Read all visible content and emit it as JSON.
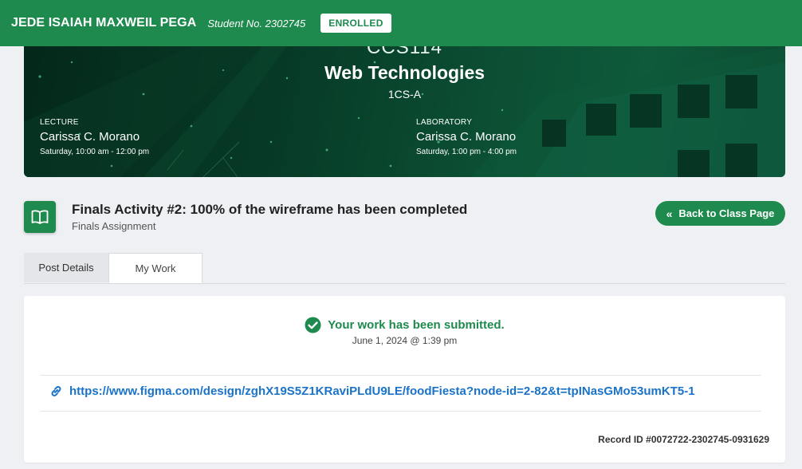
{
  "header": {
    "student_name": "JEDE ISAIAH MAXWEIL PEGA",
    "student_no": "Student No. 2302745",
    "status_badge": "ENROLLED"
  },
  "banner": {
    "course_code": "CCS114",
    "course_title": "Web Technologies",
    "section": "1CS-A",
    "lecture": {
      "label": "LECTURE",
      "instructor": "Carissa C. Morano",
      "schedule": "Saturday, 10:00 am - 12:00 pm"
    },
    "laboratory": {
      "label": "LABORATORY",
      "instructor": "Carissa C. Morano",
      "schedule": "Saturday, 1:00 pm - 4:00 pm"
    }
  },
  "assignment": {
    "icon": "book-open-icon",
    "title": "Finals Activity #2: 100% of the wireframe has been completed",
    "subtitle": "Finals Assignment",
    "back_button": "Back to Class Page"
  },
  "tabs": [
    {
      "label": "Post Details",
      "active": false
    },
    {
      "label": "My Work",
      "active": true
    }
  ],
  "work": {
    "status": "Your work has been submitted.",
    "submitted_at": "June 1, 2024 @ 1:39 pm",
    "link": "https://www.figma.com/design/zghX19S5Z1KRaviPLdU9LE/foodFiesta?node-id=2-82&t=tpINasGMo53umKT5-1",
    "record_id": "Record ID #0072722-2302745-0931629"
  },
  "colors": {
    "brand_green": "#1e8a4e",
    "link_blue": "#1a73c8"
  }
}
